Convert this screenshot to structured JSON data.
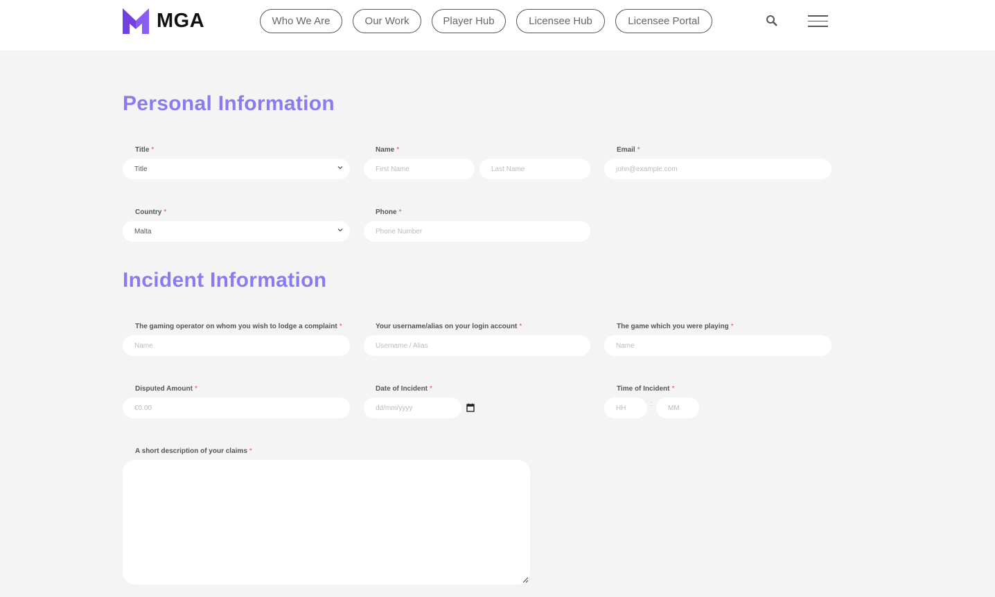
{
  "header": {
    "logo_text": "MGA",
    "nav": [
      "Who We Are",
      "Our Work",
      "Player Hub",
      "Licensee Hub",
      "Licensee Portal"
    ],
    "search_icon": "search-icon",
    "menu_icon": "hamburger-menu-icon",
    "brand_color": "#8a5cf0"
  },
  "personal": {
    "heading": "Personal Information",
    "title_label": "Title",
    "title_value": "Title",
    "name_label": "Name",
    "first_placeholder": "First Name",
    "last_placeholder": "Last Name",
    "email_label": "Email",
    "email_placeholder": "john@example.com",
    "country_label": "Country",
    "country_value": "Malta",
    "phone_label": "Phone",
    "phone_placeholder": "Phone Number"
  },
  "incident": {
    "heading": "Incident Information",
    "operator_label": "The gaming operator on whom you wish to lodge a complaint",
    "operator_placeholder": "Name",
    "username_label": "Your username/alias on your login account",
    "username_placeholder": "Username / Alias",
    "game_label": "The game which you were playing",
    "game_placeholder": "Name",
    "amount_label": "Disputed Amount",
    "amount_placeholder": "€0.00",
    "date_label": "Date of Incident",
    "date_placeholder": "dd/mm/yyyy",
    "time_label": "Time of Incident",
    "hh_placeholder": "HH",
    "colon": ":",
    "mm_placeholder": "MM",
    "desc_label": "A short description of your claims"
  },
  "required_mark": "*",
  "heading_color": "#8a7cf0"
}
